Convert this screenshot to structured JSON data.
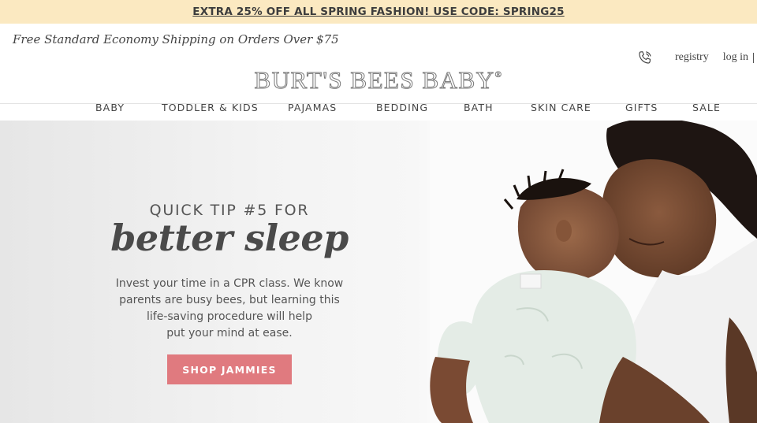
{
  "promo": {
    "text": "EXTRA 25% OFF ALL SPRING FASHION! USE CODE: SPRING25"
  },
  "header": {
    "shipping": "Free Standard Economy Shipping on Orders Over $75",
    "logo": "BURT'S BEES BABY",
    "logo_mark": "®",
    "utility": {
      "phone_icon": "phone-icon",
      "registry": "registry",
      "login": "log in"
    }
  },
  "nav": {
    "items": [
      {
        "label": "BABY"
      },
      {
        "label": "TODDLER & KIDS"
      },
      {
        "label": "PAJAMAS"
      },
      {
        "label": "BEDDING"
      },
      {
        "label": "BATH"
      },
      {
        "label": "SKIN CARE"
      },
      {
        "label": "GIFTS"
      },
      {
        "label": "SALE"
      }
    ]
  },
  "hero": {
    "heading": "QUICK TIP #5 FOR",
    "script": "better sleep",
    "body_lines": [
      "Invest your time in a CPR class. We know",
      "parents are busy bees, but learning this",
      "life-saving procedure will help",
      "put your mind at ease."
    ],
    "cta": "SHOP JAMMIES",
    "colors": {
      "cta": "#e07a7f",
      "promo_bg": "#fbe9c1"
    }
  }
}
